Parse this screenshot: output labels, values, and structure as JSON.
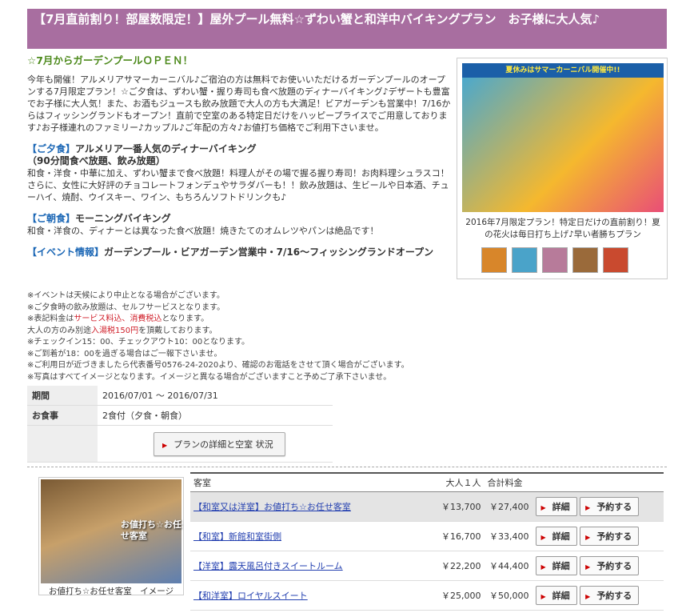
{
  "title": "【7月直前割り！部屋数限定！】屋外プール無料☆ずわい蟹と和洋中バイキングプラン　お子様に大人気♪",
  "subhead": "☆7月からガーデンプールＯＰＥＮ！",
  "intro": "今年も開催！アルメリアサマーカーニバル♪ご宿泊の方は無料でお使いいただけるガーデンプールのオープンする7月限定プラン！☆ご夕食は、ずわい蟹・握り寿司も食べ放題のディナーバイキング♪デザートも豊富でお子様に大人気！また、お酒もジュースも飲み放題で大人の方も大満足！ビアガーデンも営業中！7/16からはフィッシングランドもオープン！直前で空室のある特定日だけをハッピープライスでご用意しております♪お子様連れのファミリー♪カップル♪ご年配の方々♪お値打ち価格でご利用下さいませ。",
  "dinner": {
    "label": "【ご夕食】",
    "head1": "アルメリア一番人気のディナーバイキング",
    "head2": "（90分間食べ放題、飲み放題）",
    "body": "和食・洋食・中華に加え、ずわい蟹まで食べ放題！料理人がその場で握る握り寿司！お肉料理シュラスコ！さらに、女性に大好評のチョコレートフォンデュやサラダバーも！！飲み放題は、生ビールや日本酒、チューハイ、焼酎、ウイスキー、ワイン、もちろんソフトドリンクも♪"
  },
  "breakfast": {
    "label": "【ご朝食】",
    "head": "モーニングバイキング",
    "body": "和食・洋食の、ディナーとは異なった食べ放題！焼きたてのオムレツやパンは絶品です！"
  },
  "event": {
    "label": "【イベント情報】",
    "head": "ガーデンプール・ビアガーデン営業中・7/16〜フィッシングランドオープン"
  },
  "notes": {
    "n1": "※イベントは天候により中止となる場合がございます。",
    "n2": "※ご夕食時の飲み放題は、セルフサービスとなります。",
    "n3a": "※表記料金は",
    "n3b": "サービス料込、消費税込",
    "n3c": "となります。",
    "n4a": "大人の方のみ別途",
    "n4b": "入湯税150円",
    "n4c": "を頂戴しております。",
    "n5": "※チェックイン15：00、チェックアウト10：00となります。",
    "n6": "※ご到着が18：00を過ぎる場合はご一報下さいませ。",
    "n7": "※ご利用日が近づきましたら代表番号0576-24-2020より、確認のお電話をさせて頂く場合がございます。",
    "n8": "※写真はすべてイメージとなります。イメージと異なる場合がございますこと予めご了承下さいませ。"
  },
  "info": {
    "period_label": "期間",
    "period_value": "2016/07/01 ～ 2016/07/31",
    "meal_label": "お食事",
    "meal_value": "2食付（夕食・朝食）",
    "detail_button": "プランの詳細と空室 状況"
  },
  "promo": {
    "banner": "夏休みはサマーカーニバル開催中!!",
    "caption": "2016年7月限定プラン！特定日だけの直前割り！夏の花火は毎日打ち上げ♪早い者勝ちプラン"
  },
  "room_image": {
    "overlay": "お値打ち☆お任せ客室",
    "caption": "お値打ち☆お任せ客室　イメージ"
  },
  "rooms": {
    "headers": {
      "room": "客室",
      "adult": "大人１人",
      "total": "合計料金"
    },
    "detail_label": "詳細",
    "reserve_label": "予約する",
    "list": [
      {
        "name": "【和室又は洋室】お値打ち☆お任せ客室",
        "adult": "￥13,700",
        "total": "￥27,400"
      },
      {
        "name": "【和室】新館和室街側",
        "adult": "￥16,700",
        "total": "￥33,400"
      },
      {
        "name": "【洋室】露天風呂付きスイートルーム",
        "adult": "￥22,200",
        "total": "￥44,400"
      },
      {
        "name": "【和洋室】ロイヤルスイート",
        "adult": "￥25,000",
        "total": "￥50,000"
      }
    ]
  },
  "colors": {
    "title_bg": "#a86ea0",
    "accent_green": "#4d8a1c",
    "accent_blue": "#1a66b5",
    "accent_red": "#d0202b"
  }
}
